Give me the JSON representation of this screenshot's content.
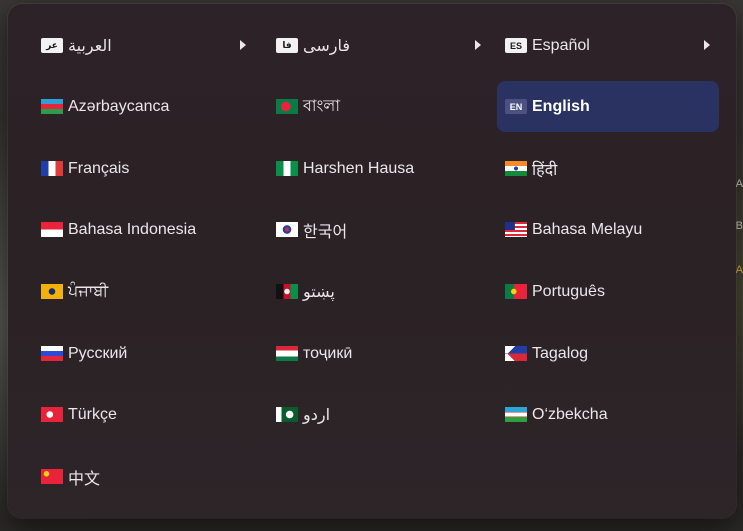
{
  "menu": {
    "columns": [
      [
        {
          "label": "العربية",
          "badge": "عر",
          "submenu": true
        },
        {
          "label": "Azərbaycanca",
          "flag": "az"
        },
        {
          "label": "Français",
          "flag": "fr"
        },
        {
          "label": "Bahasa Indonesia",
          "flag": "id"
        },
        {
          "label": "ਪੰਜਾਬੀ",
          "flag": "pa"
        },
        {
          "label": "Русский",
          "flag": "ru"
        },
        {
          "label": "Türkçe",
          "flag": "tr"
        },
        {
          "label": "中文",
          "flag": "cn"
        }
      ],
      [
        {
          "label": "فارسی",
          "badge": "فا",
          "submenu": true
        },
        {
          "label": "বাংলা",
          "flag": "bd"
        },
        {
          "label": "Harshen Hausa",
          "flag": "ng"
        },
        {
          "label": "한국어",
          "flag": "kr"
        },
        {
          "label": "پښتو",
          "flag": "af"
        },
        {
          "label": "тоҷикӣ",
          "flag": "tj"
        },
        {
          "label": "اردو",
          "flag": "pk"
        }
      ],
      [
        {
          "label": "Español",
          "badge": "ES",
          "submenu": true
        },
        {
          "label": "English",
          "badge": "EN",
          "selected": true
        },
        {
          "label": "हिंदी",
          "flag": "in"
        },
        {
          "label": "Bahasa Melayu",
          "flag": "my"
        },
        {
          "label": "Português",
          "flag": "pt"
        },
        {
          "label": "Tagalog",
          "flag": "ph"
        },
        {
          "label": "O‘zbekcha",
          "flag": "uz"
        }
      ]
    ]
  },
  "colors": {
    "selected_background": "#2a3262",
    "panel_background": "#2c2227",
    "text": "#eae6ea"
  },
  "background_edge": {
    "row1": "A",
    "row2": "B",
    "row3": "A"
  }
}
